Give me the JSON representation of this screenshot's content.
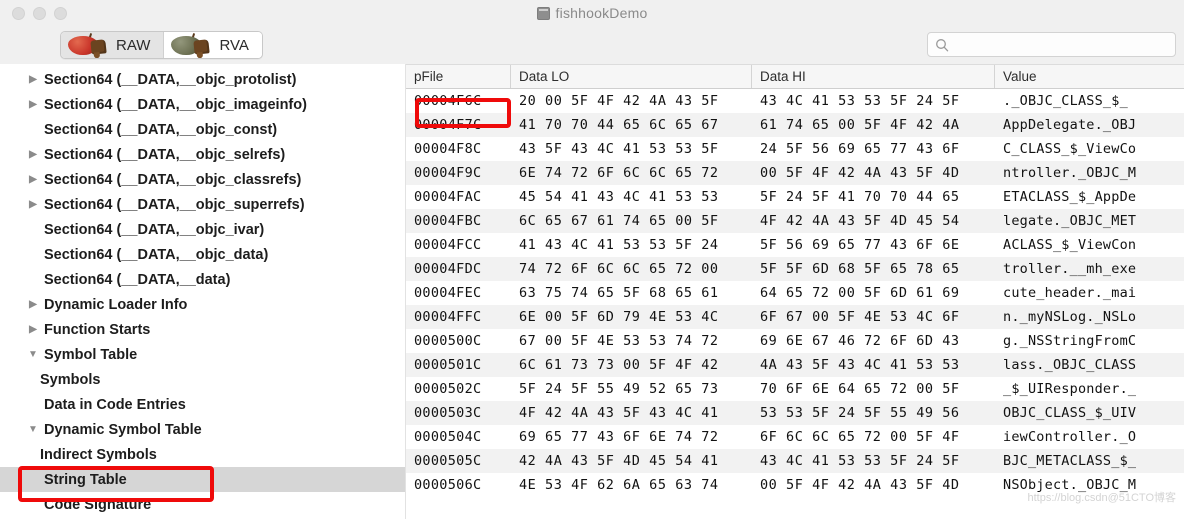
{
  "window": {
    "title": "fishhookDemo",
    "doc_icon": "document-icon",
    "traffic_lights": [
      "close",
      "minimize",
      "zoom"
    ]
  },
  "toolbar": {
    "segments": [
      {
        "label": "RAW",
        "icon": "red-apple-icon",
        "selected": true
      },
      {
        "label": "RVA",
        "icon": "green-apple-icon",
        "selected": false
      }
    ],
    "search": {
      "icon": "search-icon",
      "value": "",
      "placeholder": ""
    }
  },
  "sidebar": {
    "items": [
      {
        "label": "Section64 (__DATA,__objc_protolist)",
        "disclosure": "collapsed",
        "level": 0,
        "selected": false
      },
      {
        "label": "Section64 (__DATA,__objc_imageinfo)",
        "disclosure": "collapsed",
        "level": 0,
        "selected": false
      },
      {
        "label": "Section64 (__DATA,__objc_const)",
        "disclosure": "none",
        "level": 0,
        "selected": false
      },
      {
        "label": "Section64 (__DATA,__objc_selrefs)",
        "disclosure": "collapsed",
        "level": 0,
        "selected": false
      },
      {
        "label": "Section64 (__DATA,__objc_classrefs)",
        "disclosure": "collapsed",
        "level": 0,
        "selected": false
      },
      {
        "label": "Section64 (__DATA,__objc_superrefs)",
        "disclosure": "collapsed",
        "level": 0,
        "selected": false
      },
      {
        "label": "Section64 (__DATA,__objc_ivar)",
        "disclosure": "none",
        "level": 0,
        "selected": false
      },
      {
        "label": "Section64 (__DATA,__objc_data)",
        "disclosure": "none",
        "level": 0,
        "selected": false
      },
      {
        "label": "Section64 (__DATA,__data)",
        "disclosure": "none",
        "level": 0,
        "selected": false
      },
      {
        "label": "Dynamic Loader Info",
        "disclosure": "collapsed",
        "level": 0,
        "selected": false
      },
      {
        "label": "Function Starts",
        "disclosure": "collapsed",
        "level": 0,
        "selected": false
      },
      {
        "label": "Symbol Table",
        "disclosure": "expanded",
        "level": 0,
        "selected": false
      },
      {
        "label": "Symbols",
        "disclosure": "none",
        "level": 1,
        "selected": false
      },
      {
        "label": "Data in Code Entries",
        "disclosure": "none",
        "level": 0,
        "selected": false
      },
      {
        "label": "Dynamic Symbol Table",
        "disclosure": "expanded",
        "level": 0,
        "selected": false
      },
      {
        "label": "Indirect Symbols",
        "disclosure": "none",
        "level": 1,
        "selected": false
      },
      {
        "label": "String Table",
        "disclosure": "none",
        "level": 0,
        "selected": true
      },
      {
        "label": "Code Signature",
        "disclosure": "none",
        "level": 0,
        "selected": false
      }
    ]
  },
  "table": {
    "columns": [
      "pFile",
      "Data LO",
      "Data HI",
      "Value"
    ],
    "rows": [
      {
        "pFile": "00004F6C",
        "lo": "20 00 5F 4F 42 4A 43 5F",
        "hi": "43 4C 41 53 53 5F 24 5F",
        "value": " ._OBJC_CLASS_$_"
      },
      {
        "pFile": "00004F7C",
        "lo": "41 70 70 44 65 6C 65 67",
        "hi": "61 74 65 00 5F 4F 42 4A",
        "value": "AppDelegate._OBJ"
      },
      {
        "pFile": "00004F8C",
        "lo": "43 5F 43 4C 41 53 53 5F",
        "hi": "24 5F 56 69 65 77 43 6F",
        "value": "C_CLASS_$_ViewCo"
      },
      {
        "pFile": "00004F9C",
        "lo": "6E 74 72 6F 6C 6C 65 72",
        "hi": "00 5F 4F 42 4A 43 5F 4D",
        "value": "ntroller._OBJC_M"
      },
      {
        "pFile": "00004FAC",
        "lo": "45 54 41 43 4C 41 53 53",
        "hi": "5F 24 5F 41 70 70 44 65",
        "value": "ETACLASS_$_AppDe"
      },
      {
        "pFile": "00004FBC",
        "lo": "6C 65 67 61 74 65 00 5F",
        "hi": "4F 42 4A 43 5F 4D 45 54",
        "value": "legate._OBJC_MET"
      },
      {
        "pFile": "00004FCC",
        "lo": "41 43 4C 41 53 53 5F 24",
        "hi": "5F 56 69 65 77 43 6F 6E",
        "value": "ACLASS_$_ViewCon"
      },
      {
        "pFile": "00004FDC",
        "lo": "74 72 6F 6C 6C 65 72 00",
        "hi": "5F 5F 6D 68 5F 65 78 65",
        "value": "troller.__mh_exe"
      },
      {
        "pFile": "00004FEC",
        "lo": "63 75 74 65 5F 68 65 61",
        "hi": "64 65 72 00 5F 6D 61 69",
        "value": "cute_header._mai"
      },
      {
        "pFile": "00004FFC",
        "lo": "6E 00 5F 6D 79 4E 53 4C",
        "hi": "6F 67 00 5F 4E 53 4C 6F",
        "value": "n._myNSLog._NSLo"
      },
      {
        "pFile": "0000500C",
        "lo": "67 00 5F 4E 53 53 74 72",
        "hi": "69 6E 67 46 72 6F 6D 43",
        "value": "g._NSStringFromC"
      },
      {
        "pFile": "0000501C",
        "lo": "6C 61 73 73 00 5F 4F 42",
        "hi": "4A 43 5F 43 4C 41 53 53",
        "value": "lass._OBJC_CLASS"
      },
      {
        "pFile": "0000502C",
        "lo": "5F 24 5F 55 49 52 65 73",
        "hi": "70 6F 6E 64 65 72 00 5F",
        "value": "_$_UIResponder._"
      },
      {
        "pFile": "0000503C",
        "lo": "4F 42 4A 43 5F 43 4C 41",
        "hi": "53 53 5F 24 5F 55 49 56",
        "value": "OBJC_CLASS_$_UIV"
      },
      {
        "pFile": "0000504C",
        "lo": "69 65 77 43 6F 6E 74 72",
        "hi": "6F 6C 6C 65 72 00 5F 4F",
        "value": "iewController._O"
      },
      {
        "pFile": "0000505C",
        "lo": "42 4A 43 5F 4D 45 54 41",
        "hi": "43 4C 41 53 53 5F 24 5F",
        "value": "BJC_METACLASS_$_"
      },
      {
        "pFile": "0000506C",
        "lo": "4E 53 4F 62 6A 65 63 74",
        "hi": "00 5F 4F 42 4A 43 5F 4D",
        "value": "NSObject._OBJC_M"
      }
    ]
  },
  "annotations": {
    "accent_color": "#ef0a0a",
    "boxes": [
      {
        "name": "pfile-highlight",
        "target": "00004F6C"
      },
      {
        "name": "string-table-highlight",
        "target": "String Table"
      }
    ]
  },
  "watermark": {
    "text": "https://blog.csdn@51CTO博客"
  }
}
